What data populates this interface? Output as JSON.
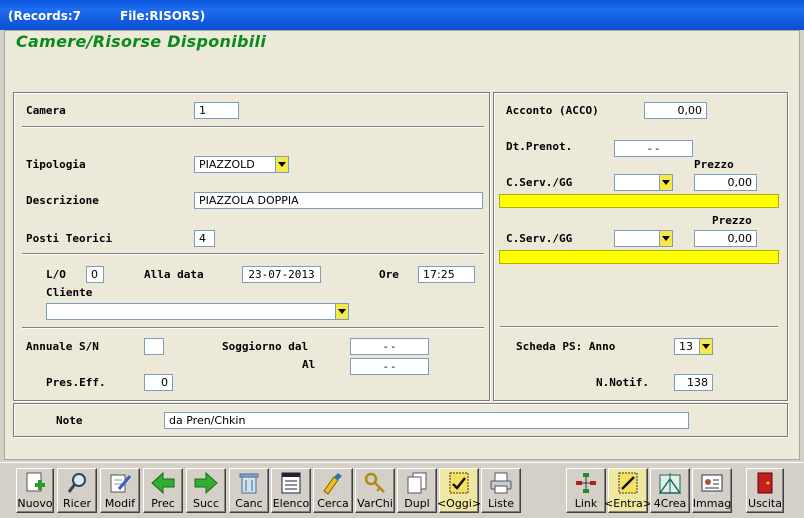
{
  "titlebar": {
    "records": "(Records:7",
    "file": "File:RISORS)"
  },
  "form_title": "Camere/Risorse Disponibili",
  "left": {
    "camera": {
      "label": "Camera",
      "value": "1"
    },
    "tipologia": {
      "label": "Tipologia",
      "value": "PIAZZOLD"
    },
    "descrizione": {
      "label": "Descrizione",
      "value": "PIAZZOLA DOPPIA"
    },
    "posti": {
      "label": "Posti Teorici",
      "value": "4"
    },
    "lo": {
      "label": "L/O",
      "value": "0"
    },
    "alla_data": {
      "label": "Alla data",
      "value": "23-07-2013"
    },
    "ore": {
      "label": "Ore",
      "value": "17:25"
    },
    "cliente": {
      "label": "Cliente",
      "value": ""
    },
    "annuale": {
      "label": "Annuale S/N",
      "value": ""
    },
    "soggiorno_dal": {
      "label": "Soggiorno dal",
      "value": "-  -"
    },
    "al": {
      "label": "Al",
      "value": "-  -"
    },
    "pres_eff": {
      "label": "Pres.Eff.",
      "value": "0"
    }
  },
  "right": {
    "acconto": {
      "label": "Acconto (ACCO)",
      "value": "0,00"
    },
    "dt_prenot": {
      "label": "Dt.Prenot.",
      "value": "-  -"
    },
    "prezzo1": {
      "label": "Prezzo",
      "value": "0,00"
    },
    "cserv1": {
      "label": "C.Serv./GG",
      "value": ""
    },
    "prezzo2": {
      "label": "Prezzo",
      "value": "0,00"
    },
    "cserv2": {
      "label": "C.Serv./GG",
      "value": ""
    },
    "scheda_ps": {
      "label": "Scheda PS: Anno",
      "value": "13"
    },
    "n_notif": {
      "label": "N.Notif.",
      "value": "138"
    }
  },
  "note": {
    "label": "Note",
    "value": "da Pren/Chkin"
  },
  "toolbar": {
    "buttons": [
      {
        "label": "Nuovo",
        "icon": "new-icon"
      },
      {
        "label": "Ricer",
        "icon": "search-icon"
      },
      {
        "label": "Modif",
        "icon": "edit-icon"
      },
      {
        "label": "Prec",
        "icon": "arrow-left-icon"
      },
      {
        "label": "Succ",
        "icon": "arrow-right-icon"
      },
      {
        "label": "Canc",
        "icon": "trash-icon"
      },
      {
        "label": "Elenco",
        "icon": "list-icon"
      },
      {
        "label": "Cerca",
        "icon": "find-icon"
      },
      {
        "label": "VarChi",
        "icon": "keys-icon"
      },
      {
        "label": "Dupl",
        "icon": "duplicate-icon"
      },
      {
        "label": "<Oggi>",
        "icon": "today-icon"
      },
      {
        "label": "Liste",
        "icon": "print-icon"
      },
      {
        "label": "Link",
        "icon": "link-icon"
      },
      {
        "label": "<Entra>",
        "icon": "enter-icon"
      },
      {
        "label": "4Crea",
        "icon": "create-icon"
      },
      {
        "label": "Immag",
        "icon": "image-icon"
      },
      {
        "label": "Uscita",
        "icon": "exit-icon"
      }
    ]
  },
  "colors": {
    "title_green": "#0a8a1a",
    "yellow": "#ffff00",
    "titlebar_blue": "#0a55dd"
  }
}
